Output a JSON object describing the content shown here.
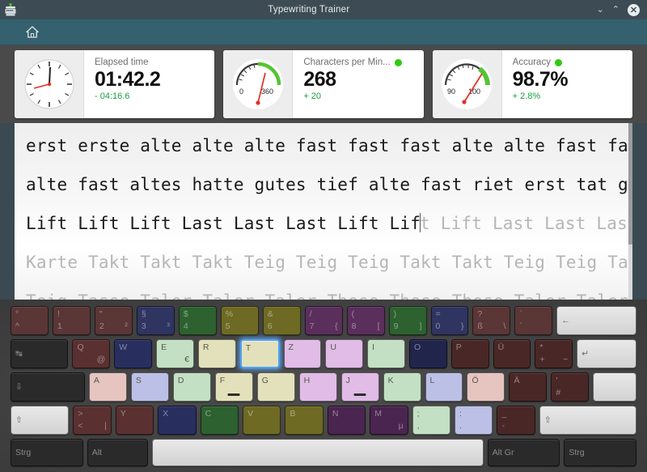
{
  "window": {
    "title": "Typewriting Trainer",
    "buttons": {
      "minimize": "⌄",
      "maximize": "⌃",
      "close": "✕"
    },
    "app_icon": "typewriter-icon"
  },
  "toolbar": {
    "home_label": "⌂",
    "home_name": "home-icon"
  },
  "stats": {
    "cards": [
      {
        "title": "Elapsed time",
        "value": "01:42.2",
        "delta": "- 04:16.6",
        "delta_color": "#1a9e3f",
        "gauge": "clock",
        "has_status_dot": false,
        "gauge_labels": []
      },
      {
        "title": "Characters per Min...",
        "value": "268",
        "delta": "+ 20",
        "delta_color": "#1a9e3f",
        "gauge": "meter",
        "has_status_dot": true,
        "status_color": "#2ecc0f",
        "gauge_labels": [
          "0",
          "360"
        ]
      },
      {
        "title": "Accuracy",
        "value": "98.7%",
        "delta": "+ 2.8%",
        "delta_color": "#1a9e3f",
        "gauge": "meter",
        "has_status_dot": true,
        "status_color": "#2ecc0f",
        "gauge_labels": [
          "90",
          "100"
        ]
      }
    ]
  },
  "training_text": {
    "lines": [
      {
        "typed": "erst erste alte alte alte fast fast fast alte alte fast fast",
        "untyped": "",
        "cursor": false
      },
      {
        "typed": "alte fast altes hatte gutes tief alte fast riet erst tat gut",
        "untyped": "",
        "cursor": false
      },
      {
        "typed": "Lift Lift Lift Last Last Last Lift Lif",
        "untyped": "t Lift Last Last Last",
        "cursor": true
      },
      {
        "typed": "",
        "untyped": "Karte Takt Takt Takt Teig Teig Teig Takt Takt Teig Teig Takt",
        "cursor": false
      },
      {
        "typed": "",
        "untyped": "Teig Tasse Taler Taler Taler These These These Taler Taler",
        "cursor": false
      }
    ]
  },
  "keyboard": {
    "layout": "German",
    "rows": [
      [
        {
          "name": "key-circumflex",
          "tl": "°",
          "bl": "^",
          "br": "",
          "color": "#5a3636",
          "w": 1
        },
        {
          "name": "key-1",
          "tl": "!",
          "bl": "1",
          "br": "",
          "color": "#5a3636",
          "w": 1
        },
        {
          "name": "key-2",
          "tl": "\"",
          "bl": "2",
          "br": "²",
          "color": "#5a3636",
          "w": 1
        },
        {
          "name": "key-3",
          "tl": "§",
          "bl": "3",
          "br": "³",
          "color": "#2f3560",
          "w": 1
        },
        {
          "name": "key-4",
          "tl": "$",
          "bl": "4",
          "br": "",
          "color": "#2d6130",
          "w": 1
        },
        {
          "name": "key-5",
          "tl": "%",
          "bl": "5",
          "br": "",
          "color": "#6e6a24",
          "w": 1
        },
        {
          "name": "key-6",
          "tl": "&",
          "bl": "6",
          "br": "",
          "color": "#6e6a24",
          "w": 1
        },
        {
          "name": "key-7",
          "tl": "/",
          "bl": "7",
          "br": "{",
          "color": "#5a2f5c",
          "w": 1
        },
        {
          "name": "key-8",
          "tl": "(",
          "bl": "8",
          "br": "[",
          "color": "#5a2f5c",
          "w": 1
        },
        {
          "name": "key-9",
          "tl": ")",
          "bl": "9",
          "br": "]",
          "color": "#2d6130",
          "w": 1
        },
        {
          "name": "key-0",
          "tl": "=",
          "bl": "0",
          "br": "}",
          "color": "#2f3560",
          "w": 1
        },
        {
          "name": "key-eszett",
          "tl": "?",
          "bl": "ß",
          "br": "\\",
          "color": "#5a3636",
          "w": 1
        },
        {
          "name": "key-acute",
          "tl": "`",
          "bl": "´",
          "br": "",
          "color": "#5a3636",
          "w": 1
        },
        {
          "name": "key-backspace",
          "c": "←",
          "style": "light",
          "w": 2.15
        }
      ],
      [
        {
          "name": "key-tab",
          "c": "↹",
          "style": "dark",
          "w": 1.55
        },
        {
          "name": "key-q",
          "tl": "Q",
          "br": "@",
          "color": "#5a3030",
          "w": 1
        },
        {
          "name": "key-w",
          "tl": "W",
          "color": "#282e5e",
          "w": 1
        },
        {
          "name": "key-e",
          "tl": "E",
          "br": "€",
          "color": "#c3e0c4",
          "light_text": true,
          "w": 1
        },
        {
          "name": "key-r",
          "tl": "R",
          "color": "#e3e1bb",
          "light_text": true,
          "w": 1
        },
        {
          "name": "key-t",
          "tl": "T",
          "color": "#e3e1bb",
          "light_text": true,
          "active": true,
          "w": 1
        },
        {
          "name": "key-z",
          "tl": "Z",
          "color": "#e0bce6",
          "light_text": true,
          "w": 1
        },
        {
          "name": "key-u",
          "tl": "U",
          "color": "#e0bce6",
          "light_text": true,
          "w": 1
        },
        {
          "name": "key-i",
          "tl": "I",
          "color": "#c3e0c4",
          "light_text": true,
          "w": 1
        },
        {
          "name": "key-o",
          "tl": "O",
          "color": "#21254c",
          "w": 1
        },
        {
          "name": "key-p",
          "tl": "P",
          "color": "#4a2727",
          "w": 1
        },
        {
          "name": "key-udiaeresis",
          "tl": "Ü",
          "color": "#4a2727",
          "w": 1
        },
        {
          "name": "key-plus",
          "tl": "*",
          "bl": "+",
          "br": "~",
          "color": "#4a2727",
          "w": 1
        },
        {
          "name": "key-enter",
          "c": "↵",
          "style": "light",
          "w": 1.6
        }
      ],
      [
        {
          "name": "key-capslock",
          "c": "⇩",
          "style": "dark",
          "w": 2.0
        },
        {
          "name": "key-a",
          "tl": "A",
          "color": "#e6c4c0",
          "light_text": true,
          "w": 1
        },
        {
          "name": "key-s",
          "tl": "S",
          "color": "#bcc0e6",
          "light_text": true,
          "w": 1
        },
        {
          "name": "key-d",
          "tl": "D",
          "color": "#c3e0c4",
          "light_text": true,
          "w": 1
        },
        {
          "name": "key-f",
          "tl": "F",
          "color": "#e3e1bb",
          "light_text": true,
          "homebar": true,
          "w": 1
        },
        {
          "name": "key-g",
          "tl": "G",
          "color": "#e3e1bb",
          "light_text": true,
          "w": 1
        },
        {
          "name": "key-h",
          "tl": "H",
          "color": "#e0bce6",
          "light_text": true,
          "w": 1
        },
        {
          "name": "key-j",
          "tl": "J",
          "color": "#e0bce6",
          "light_text": true,
          "homebar": true,
          "w": 1
        },
        {
          "name": "key-k",
          "tl": "K",
          "color": "#c3e0c4",
          "light_text": true,
          "w": 1
        },
        {
          "name": "key-l",
          "tl": "L",
          "color": "#bcc0e6",
          "light_text": true,
          "w": 1
        },
        {
          "name": "key-odiaeresis",
          "tl": "Ö",
          "color": "#e6c4c0",
          "light_text": true,
          "w": 1
        },
        {
          "name": "key-adiaeresis",
          "tl": "Ä",
          "color": "#4a2727",
          "w": 1
        },
        {
          "name": "key-hash",
          "tl": "'",
          "bl": "#",
          "color": "#4a2727",
          "w": 1
        },
        {
          "name": "key-enter-lower",
          "c": "",
          "style": "light",
          "w": 1.15
        }
      ],
      [
        {
          "name": "key-shift-left",
          "c": "⇧",
          "style": "light",
          "w": 1.55
        },
        {
          "name": "key-less",
          "tl": ">",
          "bl": "<",
          "br": "|",
          "color": "#5a3030",
          "w": 1
        },
        {
          "name": "key-y",
          "tl": "Y",
          "color": "#5a3030",
          "w": 1
        },
        {
          "name": "key-x",
          "tl": "X",
          "color": "#282e5e",
          "w": 1
        },
        {
          "name": "key-c",
          "tl": "C",
          "color": "#2d6130",
          "w": 1
        },
        {
          "name": "key-v",
          "tl": "V",
          "color": "#6e6a24",
          "w": 1
        },
        {
          "name": "key-b",
          "tl": "B",
          "color": "#6e6a24",
          "w": 1
        },
        {
          "name": "key-n",
          "tl": "N",
          "color": "#4a2550",
          "w": 1
        },
        {
          "name": "key-m",
          "tl": "M",
          "br": "µ",
          "color": "#4a2550",
          "w": 1
        },
        {
          "name": "key-comma",
          "tl": ";",
          "bl": ",",
          "color": "#c3e0c4",
          "light_text": true,
          "w": 1
        },
        {
          "name": "key-period",
          "tl": ":",
          "bl": ".",
          "color": "#bcc0e6",
          "light_text": true,
          "w": 1
        },
        {
          "name": "key-minus",
          "tl": "_",
          "bl": "-",
          "color": "#4a2727",
          "w": 1
        },
        {
          "name": "key-shift-right",
          "c": "⇧",
          "style": "light",
          "w": 2.6
        }
      ],
      [
        {
          "name": "key-ctrl-left",
          "c": "Strg",
          "style": "dark",
          "w": 1.55
        },
        {
          "name": "key-alt",
          "c": "Alt",
          "style": "dark",
          "w": 1.3
        },
        {
          "name": "key-space",
          "c": "",
          "style": "light",
          "w": 7.2
        },
        {
          "name": "key-altgr",
          "c": "Alt Gr",
          "style": "dark",
          "w": 1.55
        },
        {
          "name": "key-ctrl-right",
          "c": "Strg",
          "style": "dark",
          "w": 1.55
        }
      ]
    ]
  }
}
